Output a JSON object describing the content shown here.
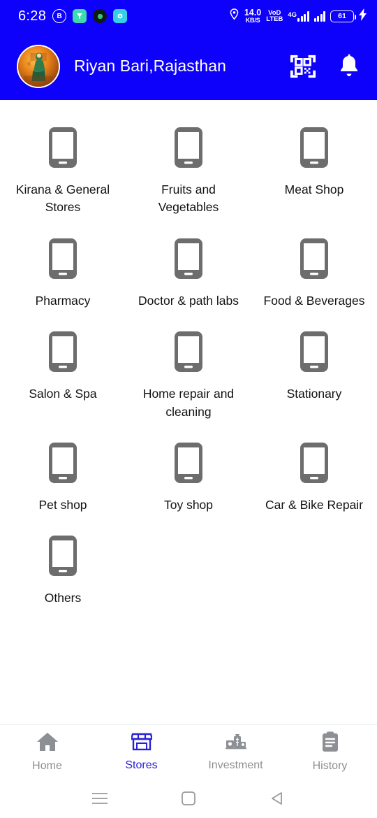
{
  "statusbar": {
    "clock": "6:28",
    "app_icons": [
      "browser-b-icon",
      "teal-app-icon",
      "dark-app-icon",
      "cyan-app-icon"
    ],
    "location_icon": "location-pin-icon",
    "network_speed_value": "14.0",
    "network_speed_unit": "KB/S",
    "volte_line1": "VoD",
    "volte_line2": "LTEB",
    "data_type": "4G",
    "battery_percent": "61",
    "charging_icon": "charging-bolt-icon"
  },
  "appbar": {
    "avatar": "user-avatar",
    "title": "Riyan Bari,Rajasthan",
    "scan_icon": "qr-scan-icon",
    "notification_icon": "bell-icon"
  },
  "categories": [
    {
      "label": "Kirana & General Stores",
      "icon": "mobile-phone-icon"
    },
    {
      "label": "Fruits and Vegetables",
      "icon": "mobile-phone-icon"
    },
    {
      "label": "Meat Shop",
      "icon": "mobile-phone-icon"
    },
    {
      "label": "Pharmacy",
      "icon": "mobile-phone-icon"
    },
    {
      "label": "Doctor & path labs",
      "icon": "mobile-phone-icon"
    },
    {
      "label": "Food & Beverages",
      "icon": "mobile-phone-icon"
    },
    {
      "label": "Salon & Spa",
      "icon": "mobile-phone-icon"
    },
    {
      "label": "Home repair and cleaning",
      "icon": "mobile-phone-icon"
    },
    {
      "label": "Stationary",
      "icon": "mobile-phone-icon"
    },
    {
      "label": "Pet shop",
      "icon": "mobile-phone-icon"
    },
    {
      "label": "Toy shop",
      "icon": "mobile-phone-icon"
    },
    {
      "label": "Car & Bike Repair",
      "icon": "mobile-phone-icon"
    },
    {
      "label": "Others",
      "icon": "mobile-phone-icon"
    }
  ],
  "bottom_nav": {
    "items": [
      {
        "label": "Home",
        "icon": "home-icon",
        "active": false
      },
      {
        "label": "Stores",
        "icon": "storefront-icon",
        "active": true
      },
      {
        "label": "Investment",
        "icon": "money-stack-icon",
        "active": false
      },
      {
        "label": "History",
        "icon": "clipboard-icon",
        "active": false
      }
    ]
  },
  "system_nav": {
    "recents_icon": "menu-lines-icon",
    "home_icon": "square-home-icon",
    "back_icon": "triangle-back-icon"
  },
  "colors": {
    "brand_blue": "#0d00fb",
    "active_nav": "#2a21d6",
    "icon_gray": "#6d6d6d",
    "nav_gray": "#8c8f93",
    "text": "#121212"
  }
}
